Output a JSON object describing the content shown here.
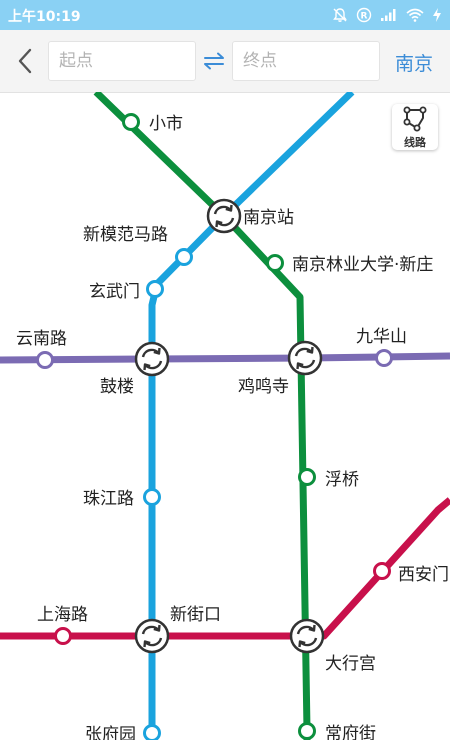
{
  "status_bar": {
    "time": "上午10:19",
    "icons": [
      "mute-icon",
      "registered-icon",
      "signal-icon",
      "wifi-icon",
      "charging-icon"
    ]
  },
  "search": {
    "start_placeholder": "起点",
    "end_placeholder": "终点",
    "city": "南京"
  },
  "line_button": {
    "label": "线路"
  },
  "colors": {
    "line_green": "#0c8f3d",
    "line_blue": "#1aa3de",
    "line_purple": "#7b6bb3",
    "line_red": "#c8104b",
    "status_bar": "#8ad1f4",
    "accent": "#3b8cd7"
  },
  "map": {
    "stations": {
      "xiaoshi": "小市",
      "nanjing_station": "南京站",
      "xinmofanmalu": "新模范马路",
      "nanjing_forestry": "南京林业大学·新庄",
      "xuanwumen": "玄武门",
      "yunnanlu": "云南路",
      "gulou": "鼓楼",
      "jimingsi": "鸡鸣寺",
      "jiuhuashan": "九华山",
      "fuqiao": "浮桥",
      "zhujianglu": "珠江路",
      "xi_anmen": "西安门",
      "shanghailu": "上海路",
      "xinjiekou": "新街口",
      "daxinggong": "大行宫",
      "zhangfuyuan": "张府园",
      "changfujie": "常府街"
    }
  }
}
